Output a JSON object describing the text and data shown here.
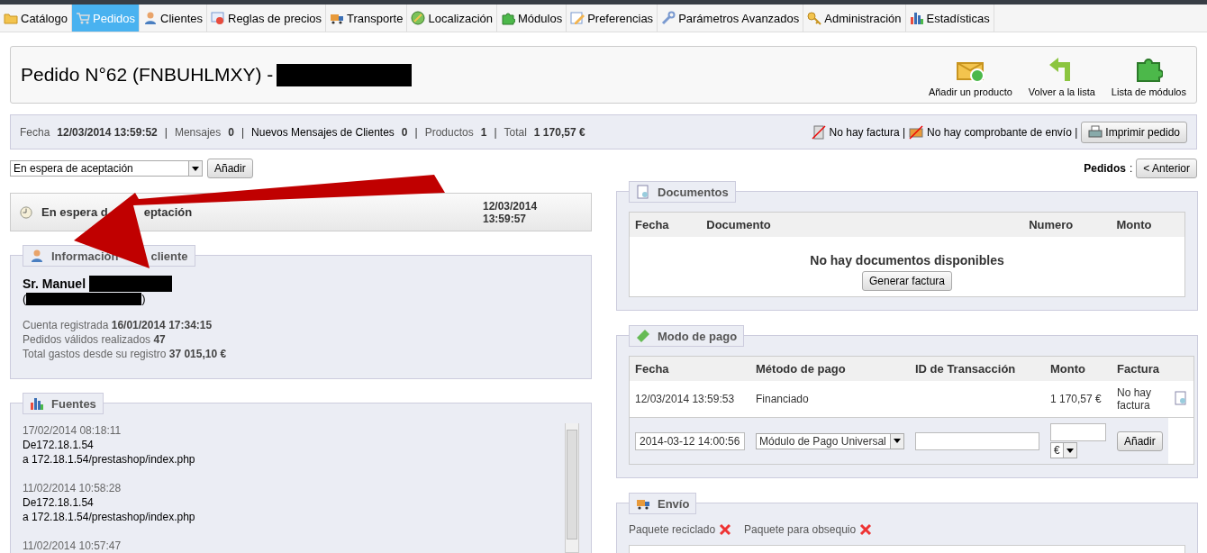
{
  "tabs": [
    {
      "label": "Catálogo",
      "selected": false
    },
    {
      "label": "Pedidos",
      "selected": true
    },
    {
      "label": "Clientes",
      "selected": false
    },
    {
      "label": "Reglas de precios",
      "selected": false
    },
    {
      "label": "Transporte",
      "selected": false
    },
    {
      "label": "Localización",
      "selected": false
    },
    {
      "label": "Módulos",
      "selected": false
    },
    {
      "label": "Preferencias",
      "selected": false
    },
    {
      "label": "Parámetros Avanzados",
      "selected": false
    },
    {
      "label": "Administración",
      "selected": false
    },
    {
      "label": "Estadísticas",
      "selected": false
    }
  ],
  "header": {
    "title": "Pedido N°62 (FNBUHLMXY) -",
    "actions": [
      "Añadir un producto",
      "Volver a la lista",
      "Lista de módulos"
    ]
  },
  "summary": {
    "items": [
      {
        "label": "Fecha",
        "value": "12/03/2014 13:59:52",
        "strong": false
      },
      {
        "separator": "|",
        "label": "Mensajes",
        "value": "0",
        "strong": false
      },
      {
        "separator": "|",
        "label": "Nuevos Mensajes de Clientes",
        "value": "0",
        "strong": true
      },
      {
        "separator": "|",
        "label": "Productos",
        "value": "1",
        "strong": false
      },
      {
        "separator": "|",
        "label": "Total",
        "value": "1 170,57 €",
        "strong": false
      }
    ],
    "invoice": "No hay factura |",
    "delivery": "No hay comprobante de envío |",
    "print_button": "Imprimir pedido"
  },
  "status_select": {
    "value": "En espera de aceptación",
    "button": "Añadir"
  },
  "navigation": {
    "label": "Pedidos",
    "separator": ":",
    "previous": "< Anterior"
  },
  "history": {
    "status_parts": [
      "En espera d",
      "eptación"
    ],
    "date": "12/03/2014",
    "time": "13:59:57"
  },
  "customer": {
    "legend_parts": [
      "Información",
      "cliente"
    ],
    "name": "Sr. Manuel",
    "open_paren": "(",
    "close_paren": ")",
    "stats": [
      {
        "label": "Cuenta registrada",
        "value": "16/01/2014 17:34:15"
      },
      {
        "label": "Pedidos válidos realizados",
        "value": "47"
      },
      {
        "label": "Total gastos desde su registro",
        "value": "37 015,10 €"
      }
    ]
  },
  "sources": {
    "legend": "Fuentes",
    "entries": [
      {
        "date": "17/02/2014 08:18:11",
        "from_label": "De",
        "from": "172.18.1.54",
        "to_label": "a",
        "to": "172.18.1.54/prestashop/index.php"
      },
      {
        "date": "11/02/2014 10:58:28",
        "from_label": "De",
        "from": "172.18.1.54",
        "to_label": "a",
        "to": "172.18.1.54/prestashop/index.php"
      },
      {
        "date": "11/02/2014 10:57:47"
      }
    ]
  },
  "documents": {
    "legend": "Documentos",
    "columns": [
      "Fecha",
      "Documento",
      "Numero",
      "Monto"
    ],
    "empty": "No hay documentos disponibles",
    "button": "Generar factura"
  },
  "payment": {
    "legend": "Modo de pago",
    "columns": [
      "Fecha",
      "Método de pago",
      "ID de Transacción",
      "Monto",
      "Factura"
    ],
    "rows": [
      {
        "date": "12/03/2014 13:59:53",
        "method": "Financiado",
        "amount": "1 170,57 €",
        "invoice": "No hay factura"
      }
    ],
    "form": {
      "date": "2014-03-12 14:00:56",
      "method": "Módulo de Pago Universal",
      "currency": "€",
      "button": "Añadir"
    }
  },
  "shipping": {
    "legend": "Envío",
    "flags": [
      {
        "label": "Paquete reciclado",
        "on": false
      },
      {
        "label": "Paquete para obsequio",
        "on": false
      }
    ]
  }
}
